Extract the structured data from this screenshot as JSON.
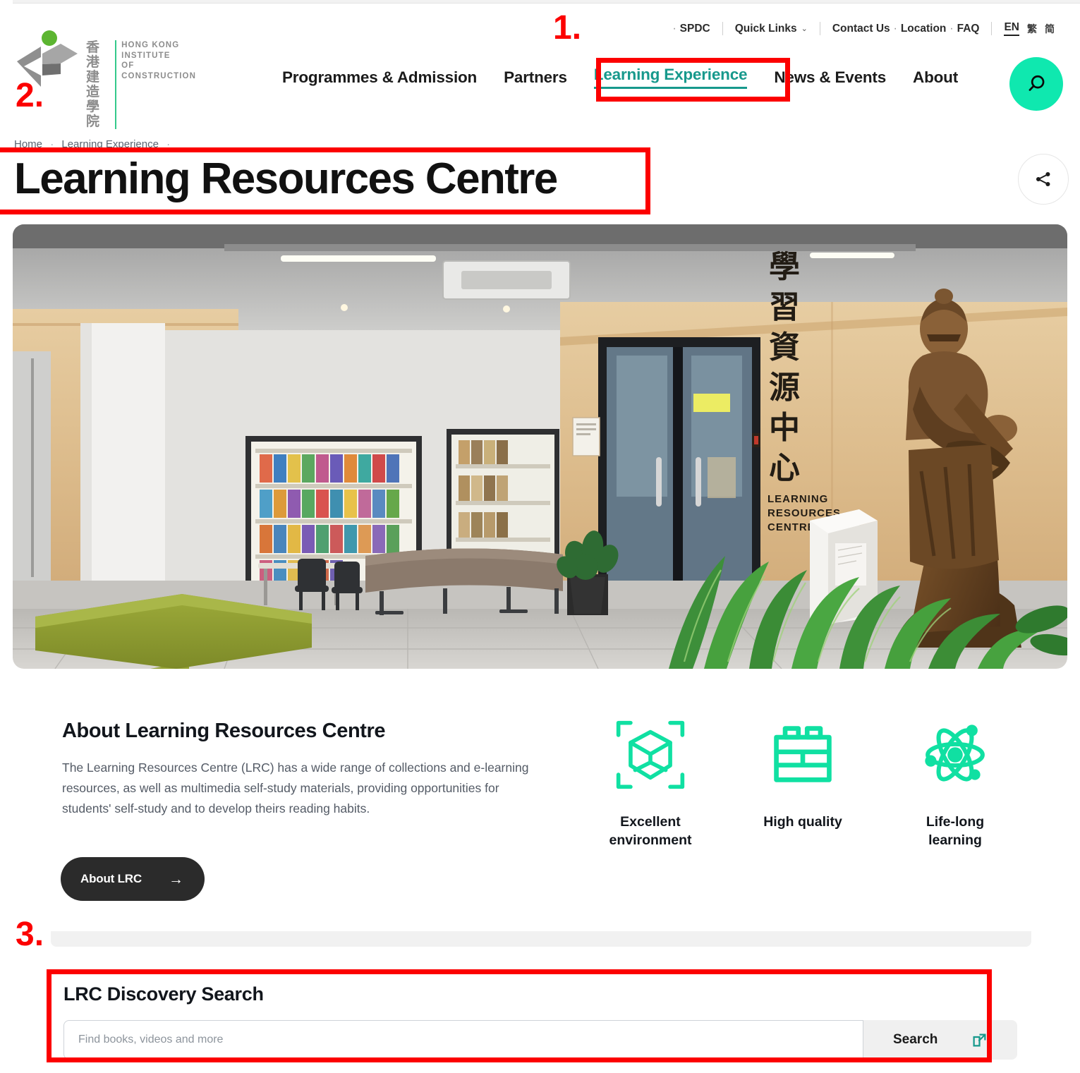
{
  "site": {
    "logo": {
      "cn_lines": [
        "香港",
        "建造",
        "學院"
      ],
      "en_lines": [
        "HONG KONG",
        "INSTITUTE",
        "OF",
        "CONSTRUCTION"
      ],
      "icon": "hkic-logo-icon",
      "accent": "#34c98b"
    }
  },
  "utility_nav": {
    "items": [
      {
        "label": "SPDC",
        "leading_dot": true
      },
      {
        "label": "Quick Links",
        "has_caret": true
      },
      {
        "label": "Contact Us",
        "leading_dot": true
      },
      {
        "label": "Location",
        "leading_dot": true
      },
      {
        "label": "FAQ",
        "leading_dot": true
      }
    ],
    "languages": [
      {
        "label": "EN",
        "active": true
      },
      {
        "label": "繁",
        "active": false
      },
      {
        "label": "简",
        "active": false
      }
    ]
  },
  "main_nav": {
    "items": [
      {
        "label": "Programmes & Admission",
        "active": false
      },
      {
        "label": "Partners",
        "active": false
      },
      {
        "label": "Learning Experience",
        "active": true
      },
      {
        "label": "News & Events",
        "active": false
      },
      {
        "label": "About",
        "active": false
      }
    ],
    "search_icon": "magnifier-icon",
    "search_button_color": "#0fe8af",
    "active_color": "#17998c"
  },
  "breadcrumb": {
    "home": "Home",
    "sep": "·",
    "section": "Learning Experience",
    "trail_sep": "·"
  },
  "page": {
    "title": "Learning Resources Centre",
    "share_icon": "share-icon"
  },
  "hero": {
    "alt": "Learning Resources Centre lobby with bookshelves, green sofa, plants and bronze statue",
    "wall_sign_cn": "學習資源中心",
    "wall_sign_en": [
      "LEARNING",
      "RESOURCES",
      "CENTRE"
    ]
  },
  "about": {
    "heading": "About Learning Resources Centre",
    "body": "The Learning Resources Centre (LRC) has a wide range of collections and e-learning resources, as well as multimedia self-study materials, providing opportunities for students' self-study and to develop theirs reading habits.",
    "button_label": "About LRC",
    "button_arrow": "→",
    "features": [
      {
        "icon": "cube-scan-icon",
        "label": "Excellent\nenvironment",
        "line1": "Excellent",
        "line2": "environment"
      },
      {
        "icon": "brick-block-icon",
        "label": "High quality",
        "line1": "High quality",
        "line2": ""
      },
      {
        "icon": "atom-icon",
        "label": "Life-long\nlearning",
        "line1": "Life-long",
        "line2": "learning"
      }
    ],
    "icon_color": "#10e0a2"
  },
  "search_section": {
    "heading": "LRC Discovery Search",
    "input_placeholder": "Find books, videos and more",
    "input_value": "",
    "button_label": "Search",
    "button_icon": "external-link-icon",
    "button_icon_color": "#17998c"
  },
  "annotations": {
    "color": "#fc0000",
    "markers": [
      {
        "number": "1.",
        "target": "learning-experience-nav-item"
      },
      {
        "number": "2.",
        "target": "page-title"
      },
      {
        "number": "3.",
        "target": "lrc-discovery-search"
      }
    ]
  }
}
